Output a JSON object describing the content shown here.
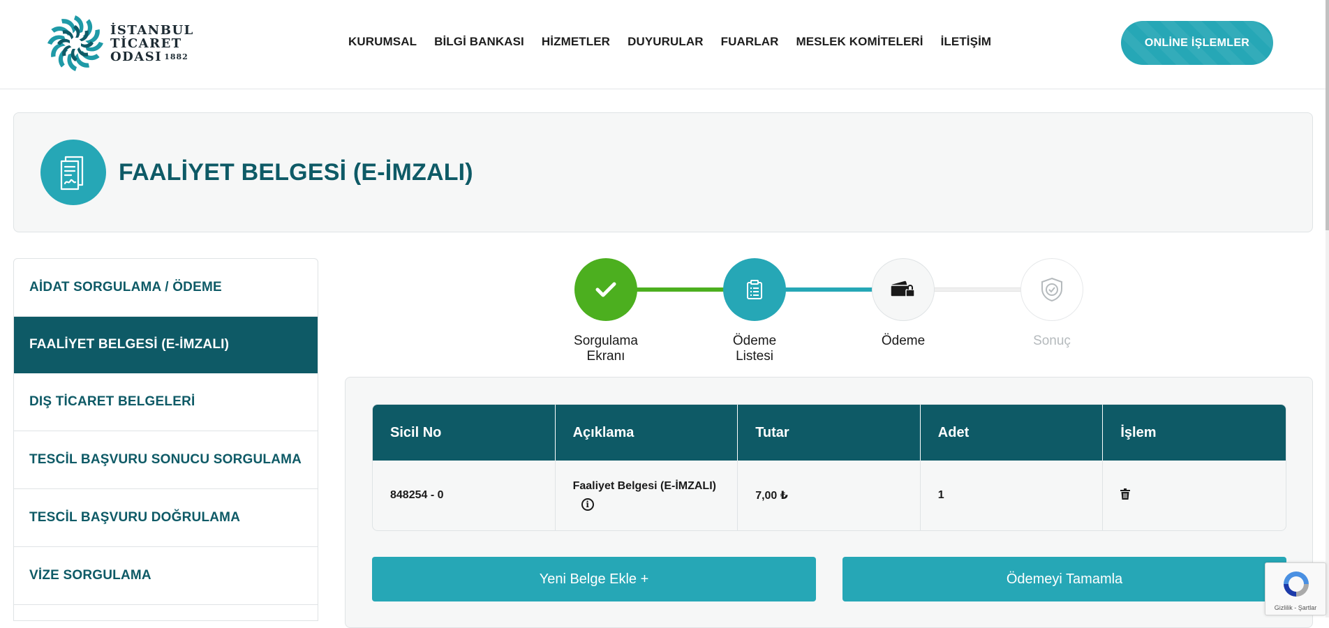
{
  "header": {
    "logo": {
      "line1": "İSTANBUL",
      "line2": "TİCARET",
      "line3": "ODASI",
      "year": "1882"
    },
    "nav": [
      "KURUMSAL",
      "BİLGİ BANKASI",
      "HİZMETLER",
      "DUYURULAR",
      "FUARLAR",
      "MESLEK KOMİTELERİ",
      "İLETİŞİM"
    ],
    "online_button": "ONLİNE İŞLEMLER"
  },
  "page": {
    "title": "FAALİYET BELGESİ (E-İMZALI)",
    "icon": "document-icon"
  },
  "sidebar": {
    "items": [
      {
        "label": "AİDAT SORGULAMA / ÖDEME",
        "active": false
      },
      {
        "label": "FAALİYET BELGESİ (E-İMZALI)",
        "active": true
      },
      {
        "label": "DIŞ TİCARET BELGELERİ",
        "active": false
      },
      {
        "label": "TESCİL BAŞVURU SONUCU SORGULAMA",
        "active": false
      },
      {
        "label": "TESCİL BAŞVURU DOĞRULAMA",
        "active": false
      },
      {
        "label": "VİZE SORGULAMA",
        "active": false
      }
    ]
  },
  "stepper": {
    "steps": [
      {
        "label_line1": "Sorgulama",
        "label_line2": "Ekranı",
        "state": "done",
        "icon": "check-icon"
      },
      {
        "label_line1": "Ödeme",
        "label_line2": "Listesi",
        "state": "current",
        "icon": "clipboard-icon"
      },
      {
        "label_line1": "Ödeme",
        "label_line2": "",
        "state": "pending",
        "icon": "wallet-lock-icon"
      },
      {
        "label_line1": "Sonuç",
        "label_line2": "",
        "state": "disabled",
        "icon": "shield-check-icon"
      }
    ]
  },
  "table": {
    "headers": [
      "Sicil No",
      "Açıklama",
      "Tutar",
      "Adet",
      "İşlem"
    ],
    "rows": [
      {
        "sicil_no": "848254 - 0",
        "aciklama": "Faaliyet Belgesi (E-İMZALI)",
        "tutar": "7,00 ₺",
        "adet": "1",
        "islem_icon": "trash-icon"
      }
    ]
  },
  "buttons": {
    "add": "Yeni Belge Ekle +",
    "complete": "Ödemeyi Tamamla"
  },
  "recaptcha": {
    "links": "Gizlilik - Şartlar"
  },
  "colors": {
    "dark_teal": "#0e5a66",
    "teal": "#26a7b6",
    "green": "#4caf1f"
  }
}
